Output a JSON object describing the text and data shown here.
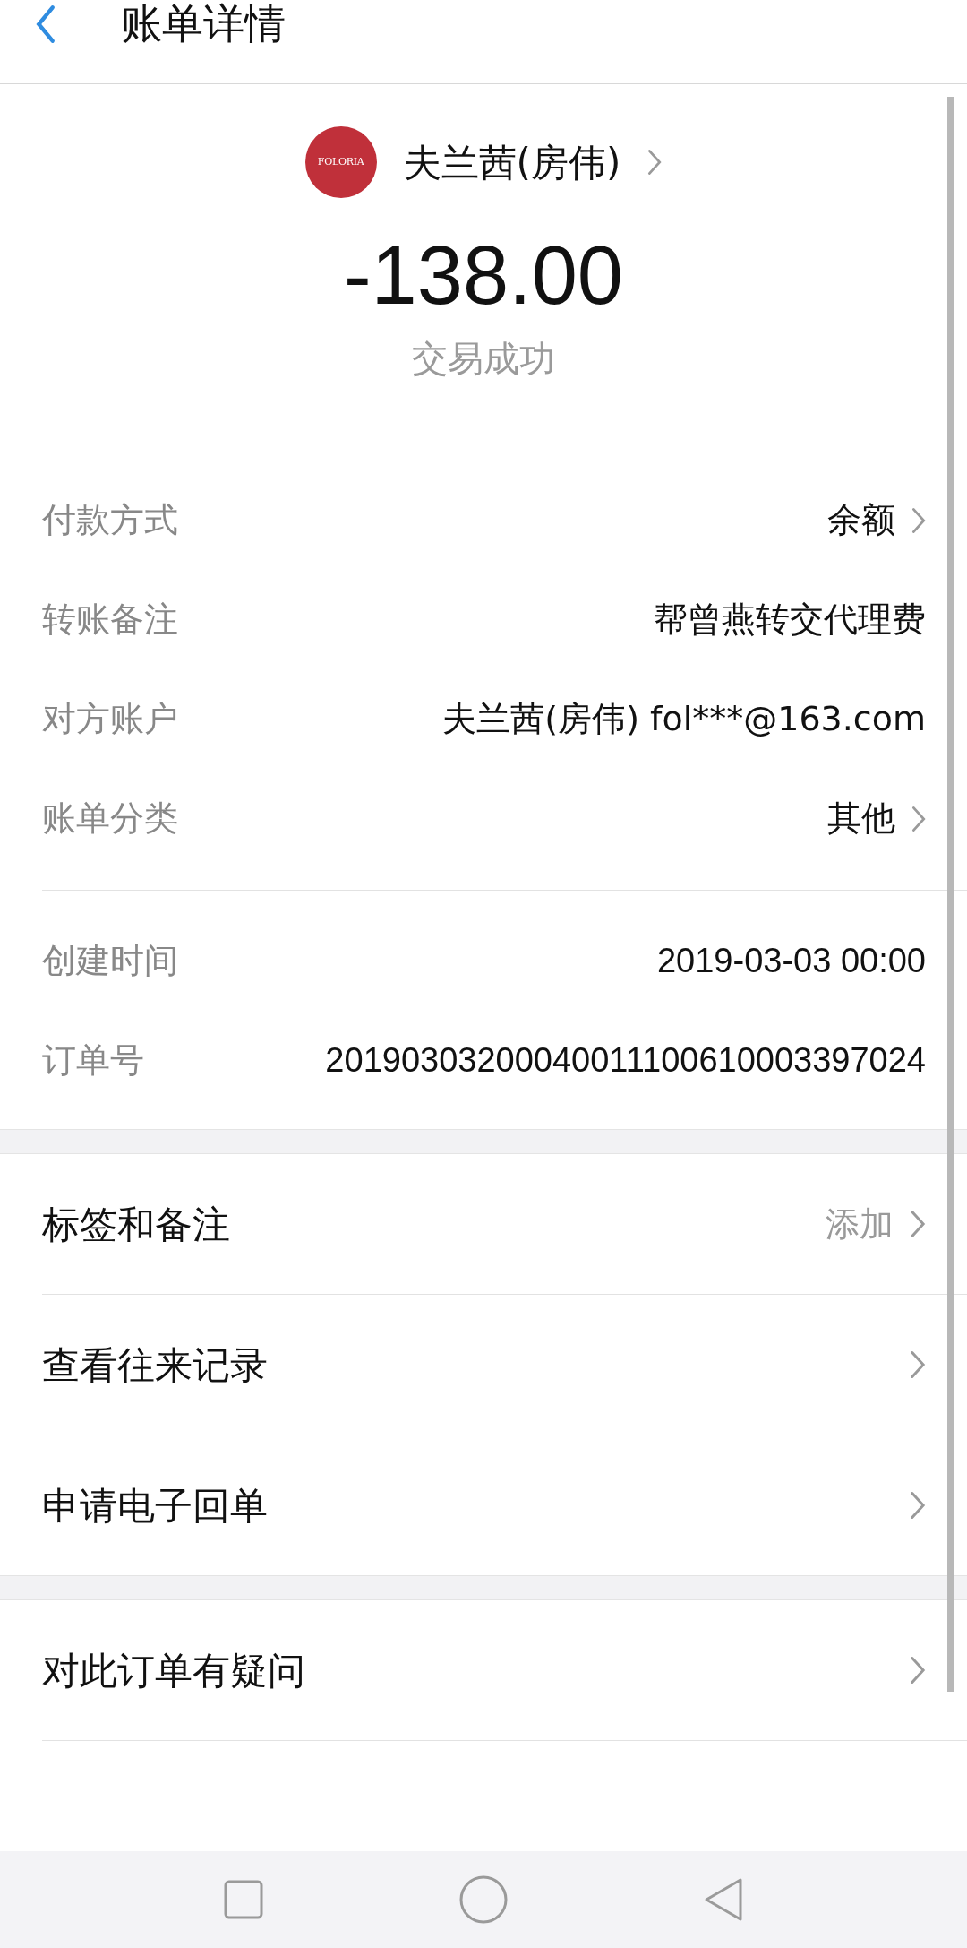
{
  "header": {
    "title": "账单详情"
  },
  "merchant": {
    "logo_text": "FOLORIA",
    "name": "夫兰茜(房伟)"
  },
  "amount": "-138.00",
  "status": "交易成功",
  "details": [
    {
      "label": "付款方式",
      "value": "余额",
      "link": true
    },
    {
      "label": "转账备注",
      "value": "帮曾燕转交代理费",
      "link": false
    },
    {
      "label": "对方账户",
      "value": "夫兰茜(房伟) fol***@163.com",
      "link": false
    },
    {
      "label": "账单分类",
      "value": "其他",
      "link": true
    }
  ],
  "meta": [
    {
      "label": "创建时间",
      "value": "2019-03-03 00:00"
    },
    {
      "label": "订单号",
      "value": "20190303200040011100610003397024"
    }
  ],
  "menu_groups": [
    [
      {
        "label": "标签和备注",
        "hint": "添加"
      },
      {
        "label": "查看往来记录"
      },
      {
        "label": "申请电子回单"
      }
    ],
    [
      {
        "label": "对此订单有疑问"
      }
    ]
  ]
}
